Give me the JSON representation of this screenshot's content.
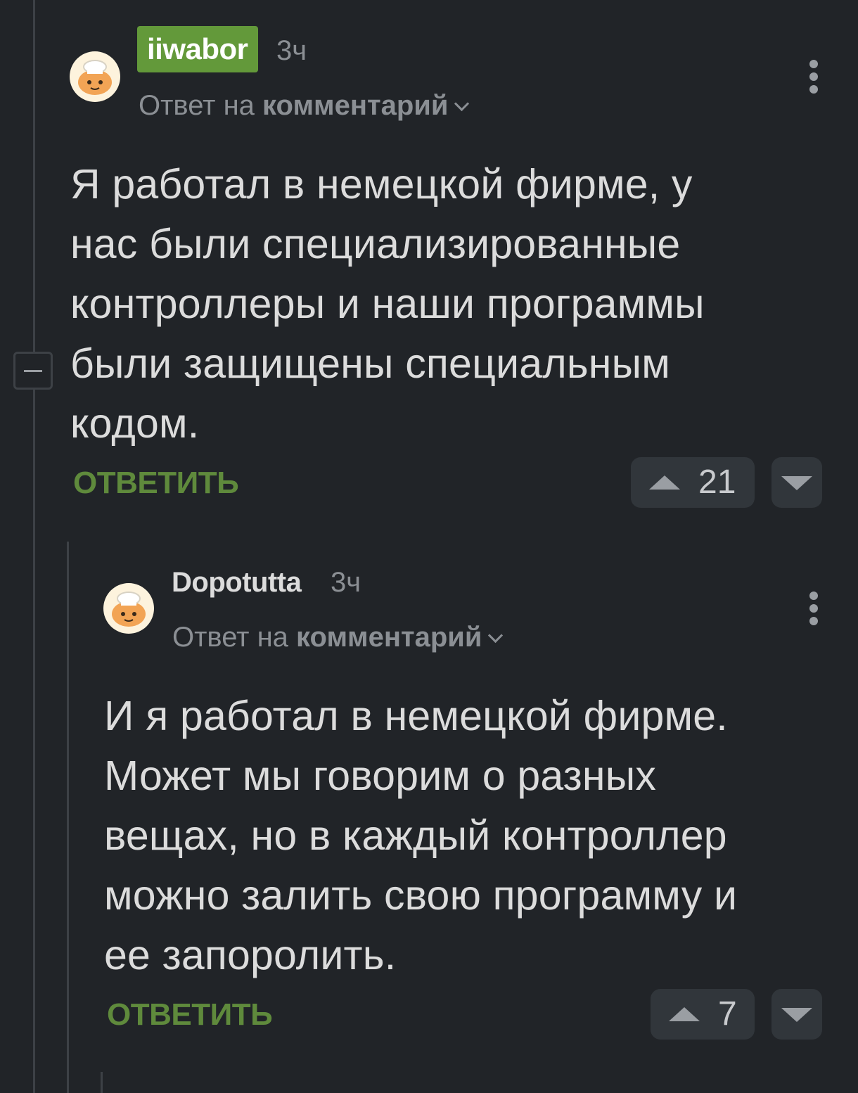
{
  "comments": [
    {
      "author": "iiwabor",
      "author_badge_color": "#63993a",
      "time": "3ч",
      "reply_prefix": "Ответ на",
      "reply_target": "комментарий",
      "text_lines": [
        "Я работал в немецкой фирме, у",
        "нас были специализированные",
        "контроллеры и наши программы",
        "были защищены специальным",
        "кодом."
      ],
      "reply_label": "ОТВЕТИТЬ",
      "rating": "21"
    },
    {
      "author": "Dopotutta",
      "time": "3ч",
      "reply_prefix": "Ответ на",
      "reply_target": "комментарий",
      "text_lines": [
        "И я работал в немецкой фирме.",
        "Может мы говорим о разных",
        "вещах, но в каждый контроллер",
        "можно залить свою программу и",
        "ее запоролить."
      ],
      "reply_label": "ОТВЕТИТЬ",
      "rating": "7"
    }
  ],
  "colors": {
    "background": "#212428",
    "accent_green": "#5f8a3c",
    "thread_line": "#3d4146"
  },
  "icons": [
    "avatar-default-icon",
    "kebab-menu-icon",
    "chevron-down-icon",
    "upvote-icon",
    "downvote-icon",
    "collapse-icon"
  ]
}
